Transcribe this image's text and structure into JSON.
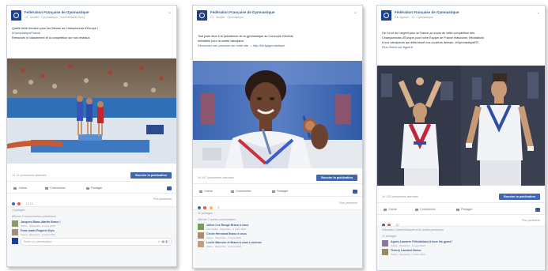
{
  "colors": {
    "brand": "#1c3f94",
    "link": "#365899",
    "button": "#4267b2",
    "muted": "#90949c"
  },
  "posts": [
    {
      "page_name": "Fédération Française de Gymnastique",
      "meta": "12 · Modifié · Gymnastique, Tours Médaille Bercy",
      "text_lines": [
        "Quelle belle émotion pour les Bleues au Championnat d'Europe !",
        "#GymnastiqueFrance",
        "Retrouvez le classement et la compétition sur nos réseaux."
      ],
      "likes_text": "12 12 personnes atteintes",
      "boost_label": "Booster la publication",
      "actions": [
        "J'aime",
        "Commenter",
        "Partager"
      ],
      "reaction_count": "12 12",
      "shares_text": "Plus pertinents",
      "shares_count": "2 partages",
      "comments_header": "Afficher 3 commentaires précédents",
      "comments": [
        {
          "name": "Jacques Blanc-Martin Bravo !",
          "sub": "J'aime · Répondre · 2 mars 2015"
        },
        {
          "name": "Fedo marie Rogeret Gym",
          "sub": "J'aime · Répondre · 2 mars 2015"
        }
      ],
      "input_placeholder": "Écrire un commentaire..."
    },
    {
      "page_name": "Fédération Française de Gymnastique",
      "meta": "24 · Modifié · Gymnastique",
      "text_lines": [
        "Tout juste élue à la présidence de la gymnastique au Concours Général,",
        "médaillée pour la soirée vainqueur.",
        "Découvrez son parcours sur notre site → http://bit.ly/gymnastique"
      ],
      "likes_text": "14 147 personnes atteintes",
      "boost_label": "Booster la publication",
      "actions": [
        "J'aime",
        "Commenter",
        "Partager"
      ],
      "reaction_count": "8",
      "shares_text": "Plus pertinents",
      "shares_count": "22 partages",
      "comments_header": "Afficher 2 autres commentaires",
      "comments": [
        {
          "name": "Julien Les Rouge Bravo à vous",
          "sub": "Vos modes · Répondre · 3 mars 2015"
        },
        {
          "name": "Cécile Hermand Bravo à vous",
          "sub": "J'aime · Répondre · 3 mars 2015"
        },
        {
          "name": "Lucile Marcure et Bravo à vous Lucienne",
          "sub": "J'aime · Répondre · 4 mars 2015"
        }
      ]
    },
    {
      "page_name": "Fédération Française de Gymnastique",
      "meta": "Par Agence · 12 · Gymnastique",
      "text_lines": [
        "De l'or et de l'argent pour la France au cours de cette compétition des",
        "Championnats d'Europe pour notre Équipe de France masculine, félicitations",
        "à nos vainqueurs qui défendront nos couleurs demain. #GymnastiqueFR",
        "Plus d'infos sur ffgym.fr"
      ],
      "likes_text": "14 152 personnes atteintes",
      "boost_label": "Booster la publication",
      "actions": [
        "J'aime",
        "Commenter",
        "Partager"
      ],
      "reaction_count": "82",
      "shares_text": "Plus pertinents",
      "shares_count": "Sébastien, Daniel Marquet et 81 autres personnes",
      "comments_header": "11 partages",
      "comments": [
        {
          "name": "Agnès Lamarre Félicitations à tous les gyms !",
          "sub": "J'aime · Répondre · 2 mars 2015"
        },
        {
          "name": "Thierry Lambert Bravo",
          "sub": "J'aime · Répondre · 2 mars 2015"
        }
      ]
    }
  ]
}
